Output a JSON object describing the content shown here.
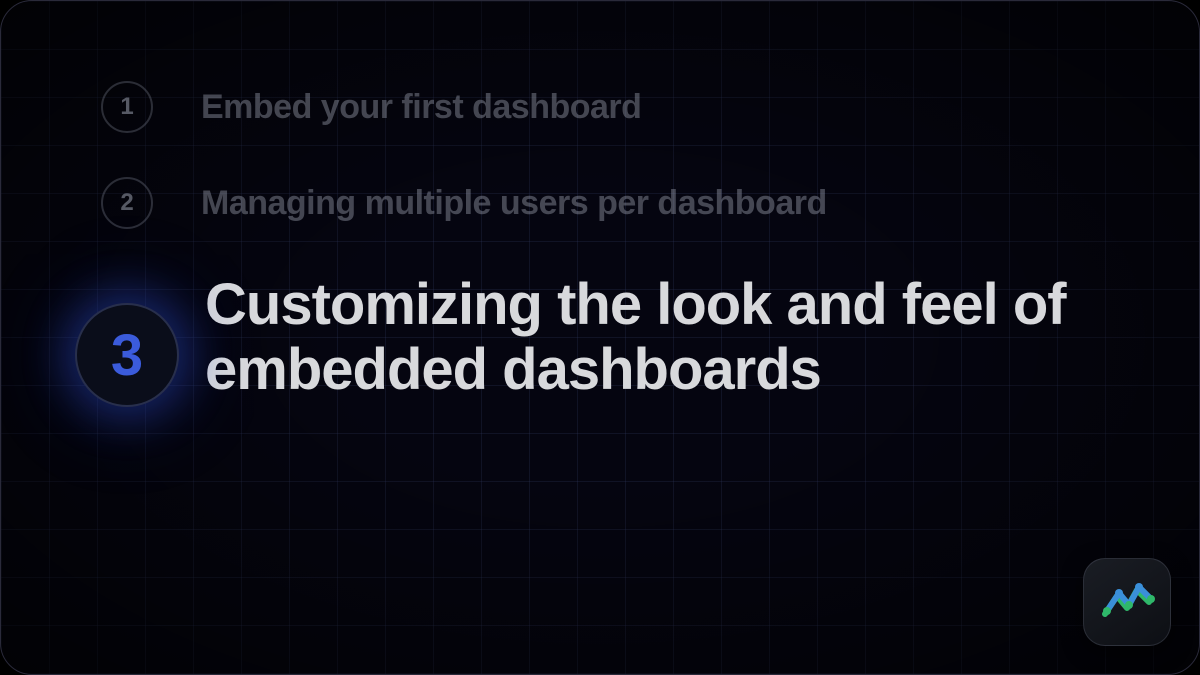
{
  "steps": [
    {
      "number": "1",
      "title": "Embed your first dashboard",
      "active": false
    },
    {
      "number": "2",
      "title": "Managing multiple users per dashboard",
      "active": false
    },
    {
      "number": "3",
      "title": "Customizing the look and feel of embedded dashboards",
      "active": true
    }
  ],
  "logo": {
    "name": "chart-line-icon"
  }
}
